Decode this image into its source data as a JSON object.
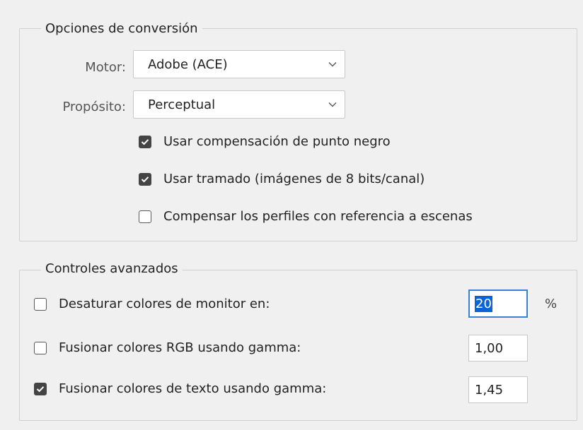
{
  "conversion": {
    "title": "Opciones de conversión",
    "engine_label": "Motor:",
    "engine_value": "Adobe (ACE)",
    "intent_label": "Propósito:",
    "intent_value": "Perceptual",
    "options": [
      {
        "label": "Usar compensación de punto negro",
        "checked": true
      },
      {
        "label": "Usar tramado (imágenes de 8 bits/canal)",
        "checked": true
      },
      {
        "label": "Compensar los perfiles con referencia a escenas",
        "checked": false
      }
    ]
  },
  "advanced": {
    "title": "Controles avanzados",
    "desaturate_label": "Desaturar colores de monitor en:",
    "desaturate_checked": false,
    "desaturate_value": "20",
    "desaturate_unit": "%",
    "blend_rgb_label": "Fusionar colores RGB usando gamma:",
    "blend_rgb_checked": false,
    "blend_rgb_value": "1,00",
    "blend_text_label": "Fusionar colores de texto usando gamma:",
    "blend_text_checked": true,
    "blend_text_value": "1,45"
  },
  "colors": {
    "focus_border": "#3b7fd6",
    "selection": "#0a64d8"
  }
}
